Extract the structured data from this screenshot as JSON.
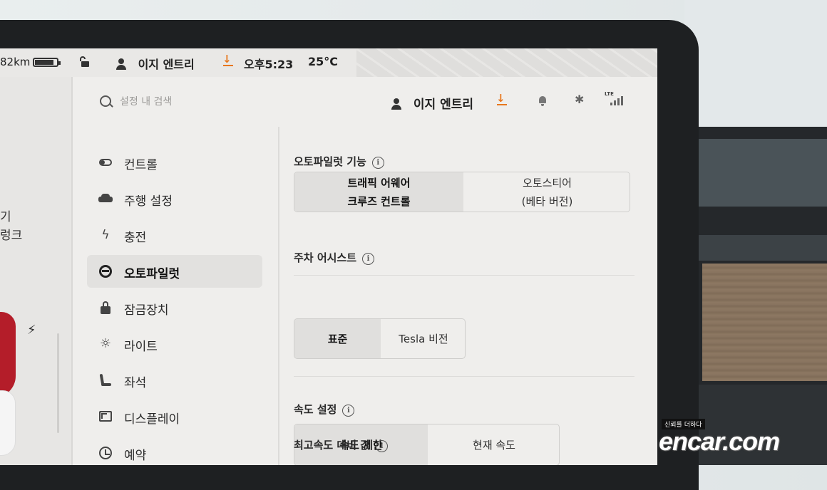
{
  "status": {
    "range": "82km",
    "battery_level": 0.8,
    "profile": "이지 엔트리",
    "time": "오후5:23",
    "temperature": "25°C"
  },
  "car_panel": {
    "label_1": "기",
    "label_2": "렁크"
  },
  "header": {
    "search_placeholder": "설정 내 검색",
    "profile": "이지 엔트리",
    "lte_label": "LTE"
  },
  "sidebar": {
    "items": [
      {
        "label": "컨트롤",
        "icon": "toggle-icon"
      },
      {
        "label": "주행 설정",
        "icon": "car-icon"
      },
      {
        "label": "충전",
        "icon": "bolt-icon"
      },
      {
        "label": "오토파일럿",
        "icon": "steering-wheel-icon",
        "active": true
      },
      {
        "label": "잠금장치",
        "icon": "lock-icon"
      },
      {
        "label": "라이트",
        "icon": "light-icon"
      },
      {
        "label": "좌석",
        "icon": "seat-icon"
      },
      {
        "label": "디스플레이",
        "icon": "display-icon"
      },
      {
        "label": "예약",
        "icon": "clock-icon"
      }
    ]
  },
  "autopilot": {
    "features_title": "오토파일럿 기능",
    "features_options": [
      {
        "line1": "트래픽 어웨어",
        "line2": "크루즈 컨트롤",
        "selected": true
      },
      {
        "line1": "오토스티어",
        "line2": "(베타 버전)",
        "selected": false
      }
    ],
    "parking_title": "주차 어시스트",
    "parking_options": [
      {
        "label": "표준",
        "selected": true
      },
      {
        "label": "Tesla 비전",
        "selected": false
      }
    ],
    "speed_title": "속도 설정",
    "speed_options": [
      {
        "label": "속도 제한",
        "selected": true
      },
      {
        "label": "현재 속도",
        "selected": false
      }
    ],
    "offset_title": "최고속도 대비 값"
  },
  "watermark": {
    "tagline": "신뢰를 더하다",
    "brand": "encar.com"
  },
  "colors": {
    "accent_download": "#e7771e",
    "screen_bg": "#efeeec",
    "selected_bg": "#e0dfdd"
  }
}
